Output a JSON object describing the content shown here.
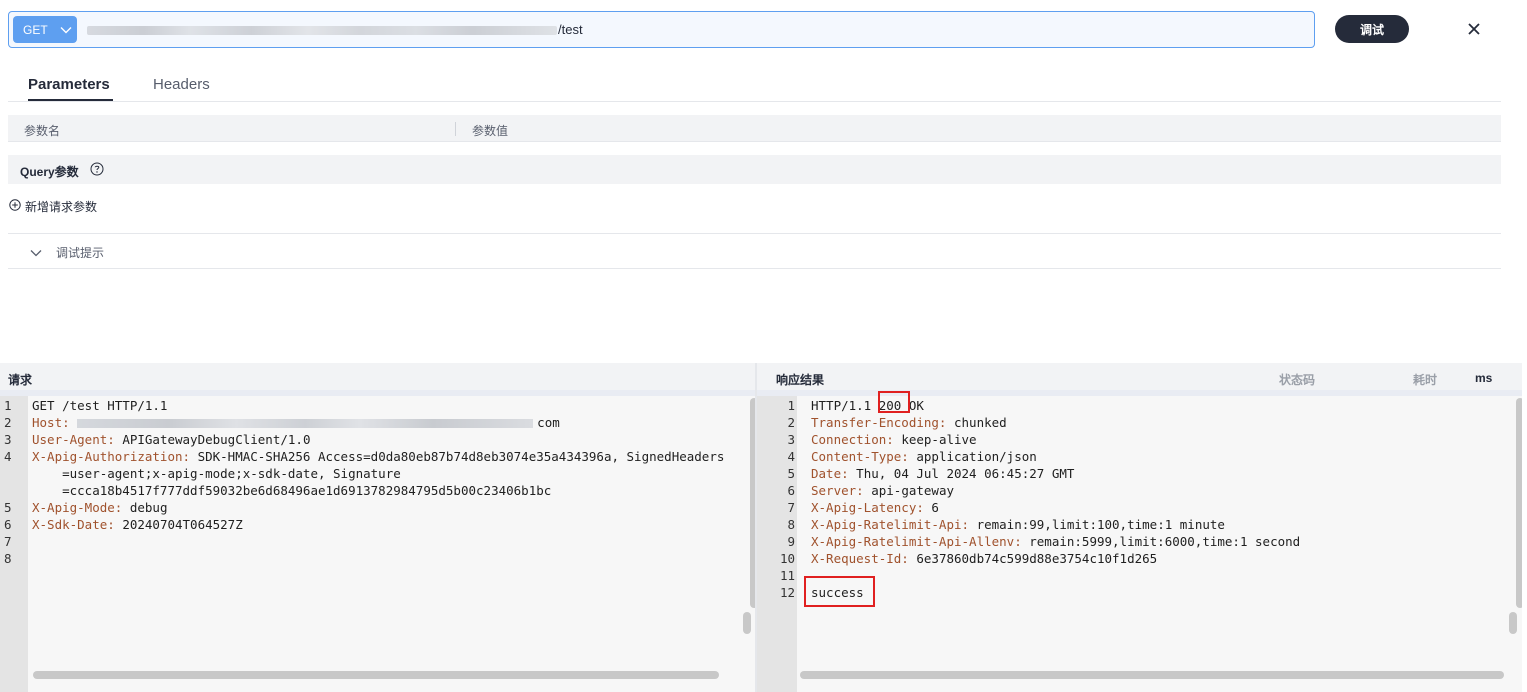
{
  "request_bar": {
    "method": "GET",
    "url_suffix": "/test",
    "debug_button_label": "调试"
  },
  "tabs": [
    {
      "label": "Parameters",
      "active": true
    },
    {
      "label": "Headers",
      "active": false
    }
  ],
  "param_table": {
    "col_name": "参数名",
    "col_value": "参数值"
  },
  "query": {
    "title": "Query参数",
    "add_label": "新增请求参数"
  },
  "tips": {
    "label": "调试提示"
  },
  "request_pane": {
    "title": "请求",
    "lines": [
      {
        "num": "1",
        "key": "",
        "value": "GET /test HTTP/1.1"
      },
      {
        "num": "2",
        "key": "Host:",
        "value": "com"
      },
      {
        "num": "3",
        "key": "User-Agent:",
        "value": " APIGatewayDebugClient/1.0"
      },
      {
        "num": "4",
        "key": "X-Apig-Authorization:",
        "value": " SDK-HMAC-SHA256 Access=d0da80eb87b74d8eb3074e35a434396a, SignedHeaders"
      },
      {
        "num": "",
        "key": "",
        "value": "    =user-agent;x-apig-mode;x-sdk-date, Signature"
      },
      {
        "num": "",
        "key": "",
        "value": "    =ccca18b4517f777ddf59032be6d68496ae1d6913782984795d5b00c23406b1bc"
      },
      {
        "num": "5",
        "key": "X-Apig-Mode:",
        "value": " debug"
      },
      {
        "num": "6",
        "key": "X-Sdk-Date:",
        "value": " 20240704T064527Z"
      },
      {
        "num": "7",
        "key": "",
        "value": ""
      },
      {
        "num": "8",
        "key": "",
        "value": ""
      }
    ]
  },
  "response_pane": {
    "title": "响应结果",
    "status_label": "状态码",
    "time_label": "耗时",
    "time_unit": "ms",
    "lines": [
      {
        "num": "1",
        "key": "",
        "value": "HTTP/1.1 200 OK"
      },
      {
        "num": "2",
        "key": "Transfer-Encoding:",
        "value": " chunked"
      },
      {
        "num": "3",
        "key": "Connection:",
        "value": " keep-alive"
      },
      {
        "num": "4",
        "key": "Content-Type:",
        "value": " application/json"
      },
      {
        "num": "5",
        "key": "Date:",
        "value": " Thu, 04 Jul 2024 06:45:27 GMT"
      },
      {
        "num": "6",
        "key": "Server:",
        "value": " api-gateway"
      },
      {
        "num": "7",
        "key": "X-Apig-Latency:",
        "value": " 6"
      },
      {
        "num": "8",
        "key": "X-Apig-Ratelimit-Api:",
        "value": " remain:99,limit:100,time:1 minute"
      },
      {
        "num": "9",
        "key": "X-Apig-Ratelimit-Api-Allenv:",
        "value": " remain:5999,limit:6000,time:1 second"
      },
      {
        "num": "10",
        "key": "X-Request-Id:",
        "value": " 6e37860db74c599d88e3754c10f1d265"
      },
      {
        "num": "11",
        "key": "",
        "value": ""
      },
      {
        "num": "12",
        "key": "",
        "value": "success"
      }
    ]
  },
  "colors": {
    "accent": "#5e9ff0",
    "header_key": "#a0522d",
    "highlight": "#e02020"
  }
}
